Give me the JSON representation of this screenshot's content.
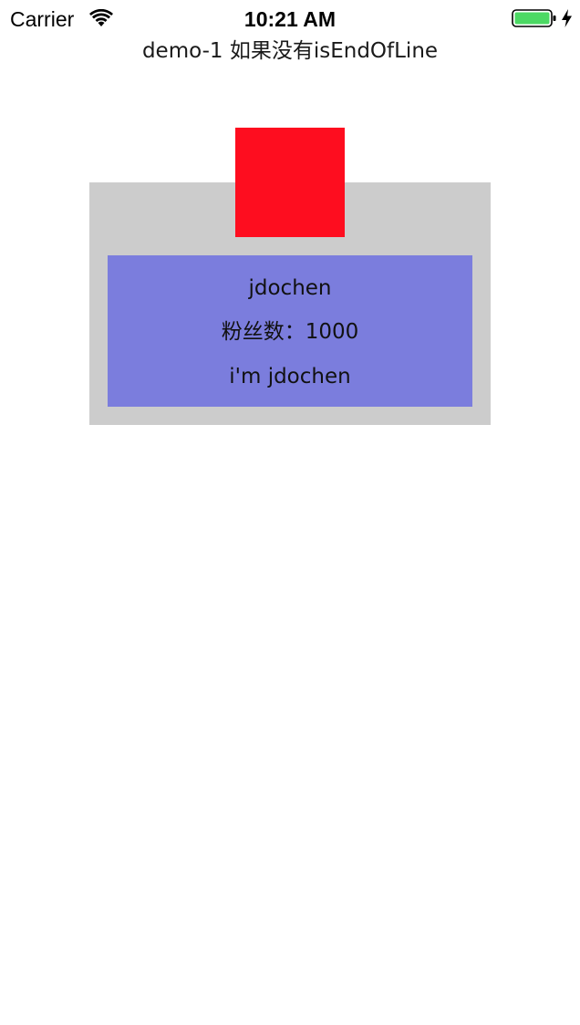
{
  "status_bar": {
    "carrier": "Carrier",
    "time": "10:21 AM",
    "icons": [
      "wifi-icon",
      "battery-icon",
      "charging-icon"
    ],
    "battery_color": "#4cd964"
  },
  "nav": {
    "title": "demo-1 如果没有isEndOfLine"
  },
  "profile": {
    "name": "jdochen",
    "followers": "粉丝数：1000",
    "bio": "i'm jdochen"
  },
  "colors": {
    "container_bg": "#cccccc",
    "avatar_red": "#fe0d1f",
    "panel_blue": "#7b7ddd"
  }
}
